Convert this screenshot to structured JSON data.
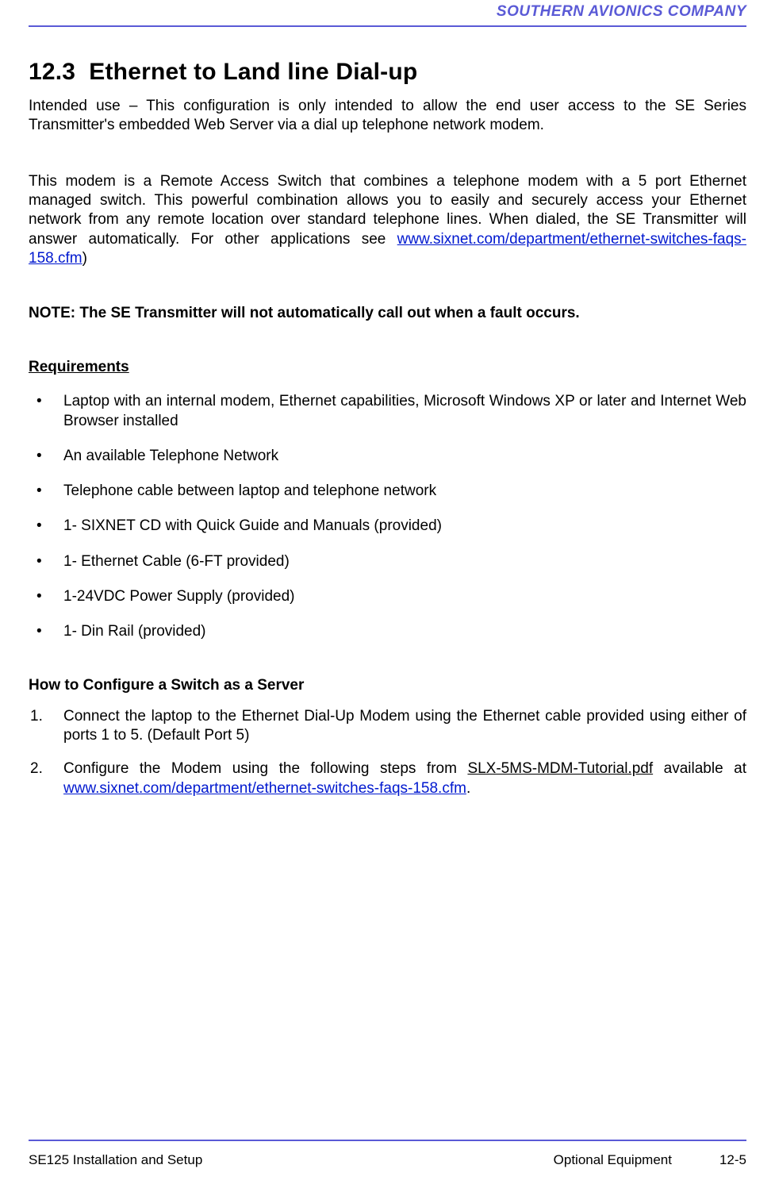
{
  "header": {
    "company": "SOUTHERN AVIONICS COMPANY"
  },
  "section": {
    "number": "12.3",
    "title": "Ethernet to Land line Dial-up"
  },
  "intro": "Intended use – This configuration is only intended to allow the end user access to the SE Series Transmitter's embedded Web Server via a dial up telephone network modem.",
  "para2_pre": "This modem is a Remote Access Switch that combines a telephone modem with a 5 port Ethernet managed switch. This powerful combination allows you to easily and securely access your Ethernet network from any remote location over standard telephone lines. When dialed, the SE Transmitter will answer automatically.  For other applications see ",
  "para2_link": "www.sixnet.com/department/ethernet-switches-faqs-158.cfm",
  "para2_post": ")",
  "note": "NOTE: The SE Transmitter will not automatically call out when a fault occurs.",
  "requirements_heading": "Requirements",
  "requirements": [
    "Laptop with an internal modem, Ethernet capabilities, Microsoft Windows XP or later and Internet Web Browser installed",
    "An available Telephone Network",
    "Telephone cable between laptop and telephone network",
    "1- SIXNET CD with Quick Guide and Manuals (provided)",
    "1- Ethernet Cable (6-FT provided)",
    "1-24VDC Power Supply (provided)",
    "1- Din Rail (provided)"
  ],
  "configure_heading": "How to Configure a Switch as a Server",
  "steps": {
    "s1": "Connect the laptop to the Ethernet Dial-Up Modem using the Ethernet cable provided using either of ports 1 to 5.   (Default Port 5)",
    "s2_pre": "Configure the Modem using the following steps from ",
    "s2_file": "SLX-5MS-MDM-Tutorial.pdf",
    "s2_mid": " available at ",
    "s2_link": "www.sixnet.com/department/ethernet-switches-faqs-158.cfm",
    "s2_post": "."
  },
  "footer": {
    "left": "SE125 Installation and Setup",
    "center": "Optional Equipment",
    "right": "12-5"
  }
}
